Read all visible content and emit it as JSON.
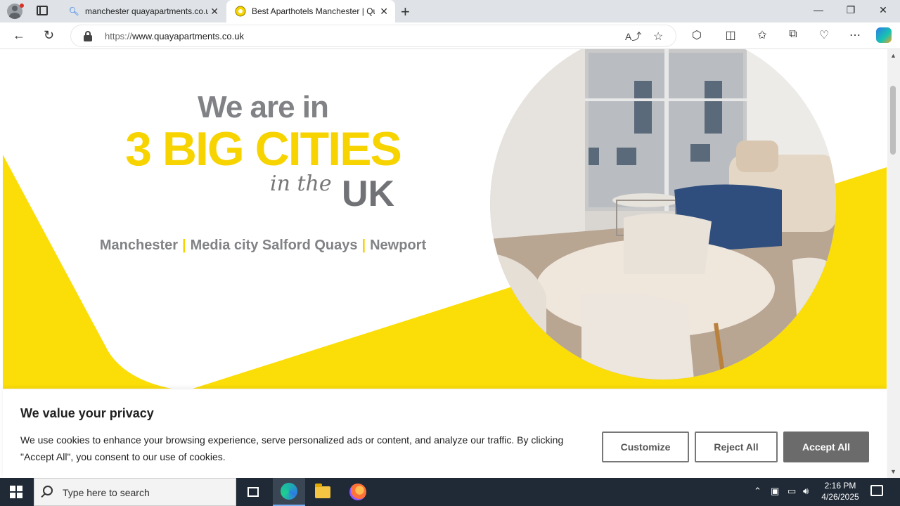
{
  "browser": {
    "tabs": [
      {
        "label": "manchester quayapartments.co.uk",
        "icon": "search-icon"
      },
      {
        "label": "Best Aparthotels Manchester | Qu",
        "icon": "site-favicon"
      }
    ],
    "url_scheme": "https://",
    "url_host": "www.quayapartments.co.uk"
  },
  "hero": {
    "line1": "We are in",
    "line2": "3 BIG CITIES",
    "line3": "in the",
    "line3_bold": "UK",
    "cities": [
      "Manchester",
      "Media city Salford Quays",
      "Newport"
    ],
    "separator": "|",
    "accent_color": "#f7d300"
  },
  "cookie": {
    "title": "We value your privacy",
    "text": "We use cookies to enhance your browsing experience, serve personalized ads or content, and analyze our traffic. By clicking \"Accept All\", you consent to our use of cookies.",
    "customize_label": "Customize",
    "reject_label": "Reject All",
    "accept_label": "Accept All"
  },
  "taskbar": {
    "search_placeholder": "Type here to search",
    "time": "2:16 PM",
    "date": "4/26/2025"
  }
}
